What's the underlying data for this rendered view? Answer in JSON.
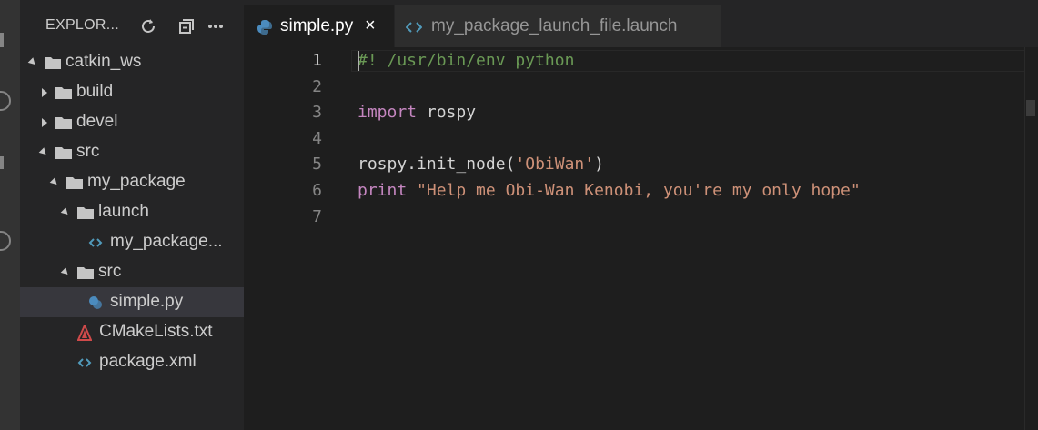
{
  "colors": {
    "python": "#4b8bbe",
    "xml": "#519aba",
    "cmake": "#d04a4a",
    "folder": "#c5c5c5",
    "button_green": "#3fb950",
    "button_blue": "#56b3e6"
  },
  "explorer": {
    "title": "EXPLOR...",
    "icons": [
      "refresh-icon",
      "collapse-all-icon",
      "more-actions-icon"
    ]
  },
  "tree": [
    {
      "label": "catkin_ws",
      "kind": "folder",
      "expanded": true,
      "depth": 0
    },
    {
      "label": "build",
      "kind": "folder",
      "expanded": false,
      "depth": 1
    },
    {
      "label": "devel",
      "kind": "folder",
      "expanded": false,
      "depth": 1
    },
    {
      "label": "src",
      "kind": "folder",
      "expanded": true,
      "depth": 1
    },
    {
      "label": "my_package",
      "kind": "folder",
      "expanded": true,
      "depth": 2
    },
    {
      "label": "launch",
      "kind": "folder",
      "expanded": true,
      "depth": 3
    },
    {
      "label": "my_package...",
      "kind": "xml",
      "depth": 4
    },
    {
      "label": "src",
      "kind": "folder",
      "expanded": true,
      "depth": 3
    },
    {
      "label": "simple.py",
      "kind": "python",
      "depth": 4,
      "selected": true
    },
    {
      "label": "CMakeLists.txt",
      "kind": "cmake",
      "depth": 3
    },
    {
      "label": "package.xml",
      "kind": "xml",
      "depth": 3
    }
  ],
  "tabs": [
    {
      "label": "simple.py",
      "icon": "python-icon",
      "active": true,
      "close": "×"
    },
    {
      "label": "my_package_launch_file.launch",
      "icon": "xml-icon",
      "active": false
    }
  ],
  "editor": {
    "line_numbers": [
      "1",
      "2",
      "3",
      "4",
      "5",
      "6",
      "7"
    ],
    "lines": [
      [
        {
          "t": "#! /usr/bin/env python",
          "c": "comment"
        }
      ],
      [],
      [
        {
          "t": "import",
          "c": "keyword"
        },
        {
          "t": " rospy",
          "c": ""
        }
      ],
      [],
      [
        {
          "t": "rospy.init_node(",
          "c": ""
        },
        {
          "t": "'ObiWan'",
          "c": "string"
        },
        {
          "t": ")",
          "c": ""
        }
      ],
      [
        {
          "t": "print",
          "c": "keyword"
        },
        {
          "t": " ",
          "c": ""
        },
        {
          "t": "\"Help me Obi-Wan Kenobi, you're my only hope\"",
          "c": "string"
        }
      ],
      []
    ]
  }
}
